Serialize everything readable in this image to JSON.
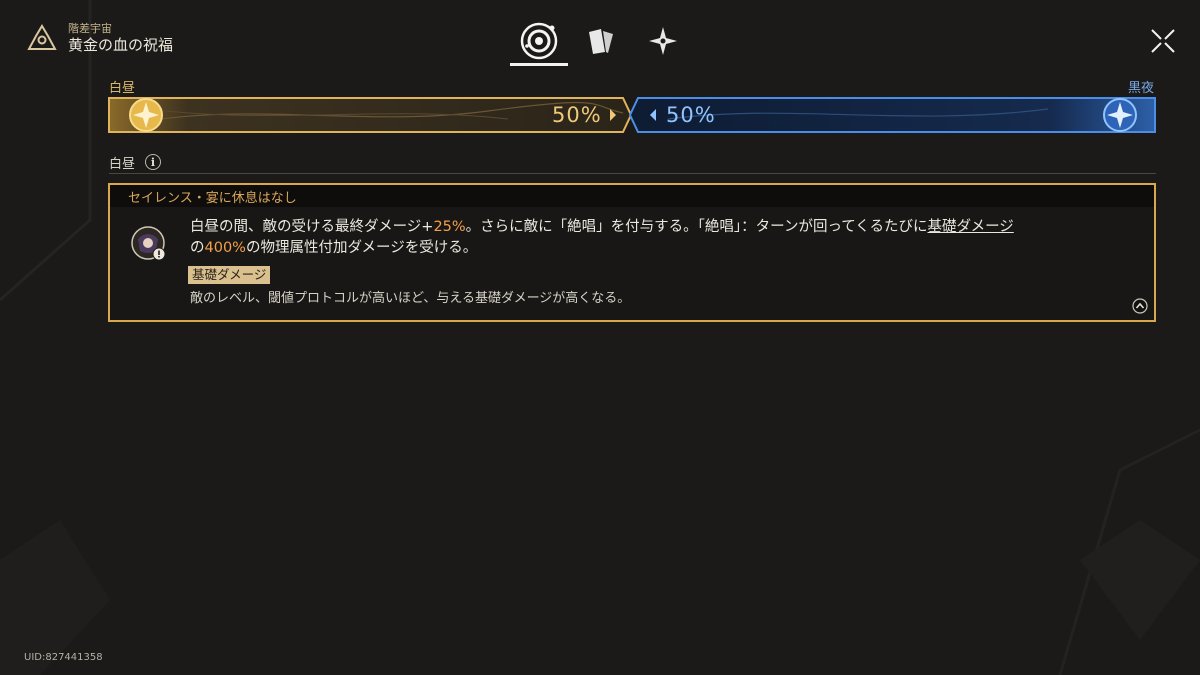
{
  "header": {
    "subtitle": "階差宇宙",
    "title": "黄金の血の祝福",
    "logo_icon": "triangle-emblem-icon"
  },
  "tabs": [
    {
      "name": "blessing-orb",
      "icon": "orb-icon",
      "active": true
    },
    {
      "name": "curio",
      "icon": "curio-card-icon",
      "active": false
    },
    {
      "name": "star",
      "icon": "four-point-star-icon",
      "active": false
    }
  ],
  "progress": {
    "left_label": "白昼",
    "right_label": "黒夜",
    "left_value": 50,
    "right_value": 50,
    "left_text": "50%",
    "right_text": "50%",
    "left_color": "#d8a84c",
    "right_color": "#3b7fd9"
  },
  "section": {
    "label": "白昼"
  },
  "card": {
    "title": "セイレンス・宴に休息はなし",
    "text": {
      "p1": "白昼の間、敵の受ける最終ダメージ+",
      "hl1": "25%",
      "p2": "。さらに敵に「絶唱」を付与する。「絶唱」：ターンが回ってくるたびに",
      "link": "基礎ダメージ",
      "p3": "の",
      "hl2": "400%",
      "p4": "の物理属性付加ダメージを受ける。"
    },
    "tag": "基礎ダメージ",
    "tag_desc": "敵のレベル、閾値プロトコルが高いほど、与える基礎ダメージが高くなる。"
  },
  "footer": {
    "uid": "UID:827441358"
  }
}
